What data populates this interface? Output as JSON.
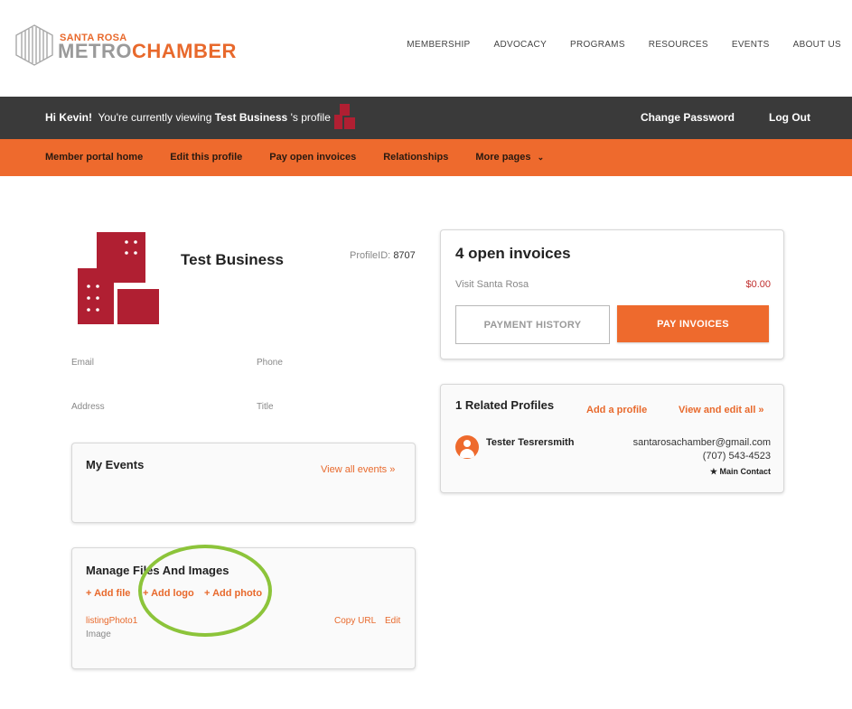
{
  "logo": {
    "top_text": "SANTA ROSA",
    "main_gray": "METRO",
    "main_orange": "CHAMBER"
  },
  "top_nav": [
    "MEMBERSHIP",
    "ADVOCACY",
    "PROGRAMS",
    "RESOURCES",
    "EVENTS",
    "ABOUT US"
  ],
  "user_bar": {
    "greeting": "Hi Kevin!",
    "viewing_prefix": "You're currently viewing",
    "business": "Test Business",
    "viewing_suffix": "'s profile",
    "change_password": "Change Password",
    "logout": "Log Out"
  },
  "sub_nav": [
    "Member portal home",
    "Edit this profile",
    "Pay open invoices",
    "Relationships",
    "More pages"
  ],
  "profile": {
    "name": "Test Business",
    "profile_id_label": "ProfileID:",
    "profile_id": "8707",
    "email_label": "Email",
    "phone_label": "Phone",
    "address_label": "Address",
    "title_label": "Title"
  },
  "events": {
    "title": "My Events",
    "view_all": "View all events »"
  },
  "files": {
    "title": "Manage Files And Images",
    "add_file": "+ Add file",
    "add_logo": "+ Add logo",
    "add_photo": "+ Add photo",
    "file_name": "listingPhoto1",
    "file_type": "Image",
    "copy_url": "Copy URL",
    "edit": "Edit"
  },
  "invoices": {
    "title": "4 open invoices",
    "org": "Visit Santa Rosa",
    "amount": "$0.00",
    "history_btn": "PAYMENT HISTORY",
    "pay_btn": "PAY INVOICES"
  },
  "related": {
    "title": "1 Related Profiles",
    "add": "Add a profile",
    "view_edit": "View and edit all »",
    "contact_name": "Tester Tesrersmith",
    "contact_email": "santarosachamber@gmail.com",
    "contact_phone": "(707) 543-4523",
    "contact_role": "★ Main Contact"
  },
  "colors": {
    "accent": "#ee6a2d",
    "dark_bar": "#3a3a3a",
    "brand_red": "#b01f32",
    "annotation": "#8cc43a"
  }
}
